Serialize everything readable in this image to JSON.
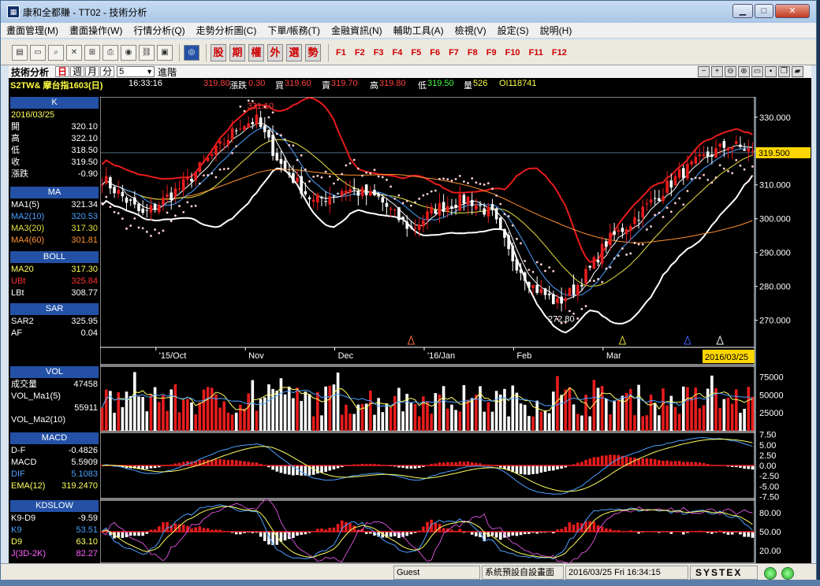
{
  "window": {
    "title": "康和全都賺 - TT02 - 技術分析",
    "app_icon": "chart-app-icon",
    "min": "▁",
    "max": "□",
    "close": "✕"
  },
  "menu": [
    "畫面管理(M)",
    "畫面操作(W)",
    "行情分析(Q)",
    "走勢分析圖(C)",
    "下單/帳務(T)",
    "金融資訊(N)",
    "輔助工具(A)",
    "檢視(V)",
    "設定(S)",
    "說明(H)"
  ],
  "toolbar": {
    "red_buttons": [
      "股",
      "期",
      "權",
      "外",
      "選",
      "勢"
    ],
    "fkeys": [
      "F1",
      "F2",
      "F3",
      "F4",
      "F5",
      "F6",
      "F7",
      "F8",
      "F9",
      "F10",
      "F11",
      "F12"
    ]
  },
  "chart_header": {
    "panel_title": "技術分析",
    "periods": [
      "日",
      "週",
      "月",
      "分"
    ],
    "selected_period": "日",
    "count": "5",
    "advanced": "進階"
  },
  "quote": {
    "symbol": "S2TW& 摩台指1603(日)",
    "time": "16:33:16",
    "last": "319.80",
    "change_label": "漲跌",
    "change": "0.30",
    "bid_label": "買",
    "bid": "319.60",
    "ask_label": "賣",
    "ask": "319.70",
    "high_label": "高",
    "high": "319.80",
    "low_label": "低",
    "low": "319.50",
    "vol_label": "量",
    "vol": "526",
    "oi": "OI118741"
  },
  "panels": {
    "k": {
      "title": "K",
      "date": "2016/03/25",
      "rows": [
        [
          "開",
          "320.10"
        ],
        [
          "高",
          "322.10"
        ],
        [
          "低",
          "318.50"
        ],
        [
          "收",
          "319.50"
        ],
        [
          "漲跌",
          "-0.90"
        ]
      ]
    },
    "ma": {
      "title": "MA",
      "rows": [
        [
          "MA1(5)",
          "321.34"
        ],
        [
          "MA2(10)",
          "320.53"
        ],
        [
          "MA3(20)",
          "317.30"
        ],
        [
          "MA4(60)",
          "301.81"
        ]
      ],
      "colors": [
        "#ffffff",
        "#4aa0ff",
        "#e8e040",
        "#ff9030"
      ]
    },
    "boll": {
      "title": "BOLL",
      "rows": [
        [
          "MA20",
          "317.30"
        ],
        [
          "UBt",
          "325.84"
        ],
        [
          "LBt",
          "308.77"
        ]
      ],
      "colors": [
        "#ffff60",
        "#ff3030",
        "#ffffff"
      ]
    },
    "sar": {
      "title": "SAR",
      "rows": [
        [
          "SAR2",
          "325.95"
        ],
        [
          "AF",
          "0.04"
        ]
      ]
    },
    "vol": {
      "title": "VOL",
      "rows": [
        [
          "成交量",
          "47458"
        ],
        [
          "VOL_Ma1(5)",
          ""
        ],
        [
          "",
          "55911"
        ],
        [
          "VOL_Ma2(10)",
          ""
        ]
      ]
    },
    "macd": {
      "title": "MACD",
      "rows": [
        [
          "D-F",
          "-0.4826"
        ],
        [
          "MACD",
          "5.5909"
        ],
        [
          "DIF",
          "5.1083"
        ],
        [
          "EMA(12)",
          "319.2470"
        ]
      ]
    },
    "kd": {
      "title": "KDSLOW",
      "rows": [
        [
          "K9-D9",
          "-9.59"
        ],
        [
          "K9",
          "53.51"
        ],
        [
          "D9",
          "63.10"
        ],
        [
          "J(3D-2K)",
          "82.27"
        ]
      ]
    }
  },
  "price_axis": {
    "ticks": [
      "330.000",
      "320.000",
      "310.000",
      "300.000",
      "290.000",
      "280.000",
      "270.000"
    ],
    "current": "319.500",
    "high_label": "331.10",
    "low_label": "272.80"
  },
  "date_axis": {
    "labels": [
      "'15/Oct",
      "Nov",
      "Dec",
      "'16/Jan",
      "Feb",
      "Mar"
    ],
    "cursor_date": "2016/03/25"
  },
  "vol_axis": {
    "ticks": [
      "75000",
      "50000",
      "25000"
    ]
  },
  "macd_axis": {
    "ticks": [
      "7.50",
      "5.00",
      "2.50",
      "0.00",
      "-2.50",
      "-5.00",
      "-7.50"
    ]
  },
  "kd_axis": {
    "ticks": [
      "80.00",
      "50.00",
      "20.00"
    ]
  },
  "status": {
    "user": "Guest",
    "layout": "系統預設自設畫面",
    "datetime": "2016/03/25 Fri 16:34:15",
    "brand": "SYSTEX"
  },
  "chart_data": {
    "type": "candlestick",
    "title": "",
    "date_range": [
      "2015-09-30",
      "2016-03-25"
    ],
    "ylim": [
      262,
      336
    ],
    "key_points": [
      {
        "label": "331.10",
        "y": 331.1
      },
      {
        "label": "272.80",
        "y": 272.8
      }
    ],
    "close_anchors": [
      [
        0,
        312
      ],
      [
        10,
        301
      ],
      [
        20,
        310
      ],
      [
        28,
        320
      ],
      [
        34,
        328
      ],
      [
        38,
        329
      ],
      [
        44,
        316
      ],
      [
        52,
        305
      ],
      [
        60,
        309
      ],
      [
        68,
        306
      ],
      [
        72,
        301
      ],
      [
        76,
        297
      ],
      [
        82,
        303
      ],
      [
        90,
        306
      ],
      [
        96,
        301
      ],
      [
        100,
        290
      ],
      [
        106,
        280
      ],
      [
        112,
        275
      ],
      [
        116,
        279
      ],
      [
        120,
        285
      ],
      [
        124,
        293
      ],
      [
        130,
        299
      ],
      [
        136,
        306
      ],
      [
        142,
        313
      ],
      [
        148,
        318
      ],
      [
        154,
        322
      ],
      [
        160,
        320
      ]
    ],
    "volume": {
      "ylim": [
        0,
        90000
      ],
      "last": 47458,
      "ma5": 55911
    },
    "macd": {
      "ylim": [
        -8,
        8
      ],
      "dif": 5.1083,
      "macd": 5.5909
    },
    "kd": {
      "ylim": [
        0,
        100
      ],
      "k": 53.51,
      "d": 63.1,
      "j": 82.27
    }
  }
}
